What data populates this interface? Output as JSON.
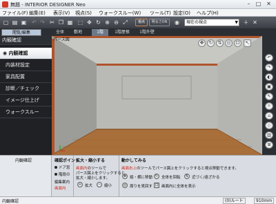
{
  "window": {
    "title": "無題 - INTERIOR DESIGNER Neo"
  },
  "menu": {
    "items": [
      "ファイル(F)",
      "編集(E)",
      "表示(V)",
      "視点(S)",
      "ウォークスルー(W)",
      "ツール(T)",
      "設定(O)",
      "ヘルプ(H)"
    ]
  },
  "toolbar": {
    "save_view": "視点",
    "show_label": "明るさON",
    "view_select": "現在の視点"
  },
  "mode_tabs": {
    "edit_tab": "閲覧/編集",
    "floor_tabs": [
      "全体",
      "敷地",
      "1階",
      "1階屋根",
      "1階外壁"
    ]
  },
  "sidebar": {
    "header": "内観確認",
    "items": [
      "内観確認",
      "内装材設定",
      "家具配置",
      "診断／チェック",
      "イメージ仕上げ",
      "ウォークスルー"
    ]
  },
  "viewport": {
    "label": "パース図"
  },
  "bottom": {
    "left_title": "内観確認",
    "point": {
      "title": "確認ポイント",
      "line1": "ドア窓",
      "line2": "階段の",
      "line3": "編集案内",
      "line4": "画面内"
    },
    "zoom": {
      "title": "拡大・縮小する",
      "text1a": "画面内",
      "text1b": "のツールで",
      "text2": "パース図上をクリックすると",
      "text3": "拡大・縮小します。",
      "zoom_in": "拡大",
      "zoom_out": "縮小"
    },
    "move": {
      "title": "動かしてみる",
      "desc_a": "画面右上",
      "desc_b": "のツールでパース図上をクリックすると視点移動できます。",
      "move_vh": "縦・横に移動",
      "rotate_all": "全体を回転",
      "forward": "近づく/遠ざかる",
      "look_around": "周りを見回す",
      "fit_view": "画面内に全体を表示"
    }
  },
  "status": {
    "left": "内観確認",
    "mid": "(0)ルート",
    "right": "910mm"
  }
}
